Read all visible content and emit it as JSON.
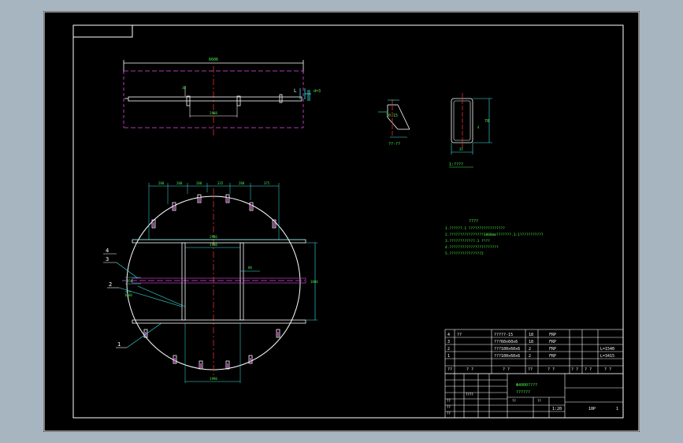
{
  "drawing": {
    "top_view": {
      "overall_dim": "6606",
      "left_tag": "30",
      "center_dim": "2988",
      "right_note": "d=3",
      "right_tag": "L"
    },
    "detail_a": {
      "dim": "70.15",
      "caption": "??-??"
    },
    "detail_b": {
      "caption": "1:????",
      "dim_h": "78",
      "dim_w": "35",
      "dim_side": "4"
    },
    "plan_view": {
      "top_dims": [
        "280",
        "280",
        "280",
        "335",
        "280",
        "375"
      ],
      "inner_dim": "2986",
      "mid_dim": "1900",
      "right_dim": "1884",
      "center_label": "80",
      "small_dim": "1060",
      "left_dim": "150",
      "bottom_dim": "1990",
      "callouts": [
        "4",
        "3",
        "2",
        "1"
      ]
    },
    "notes": {
      "title": "????",
      "lines": [
        "1.??????.1 ?????????????????",
        "2.????????????????3000mm???????.1:1???????????",
        "3.????????????.1 ????",
        "4.???????????????????????",
        "5.???????????????2"
      ]
    },
    "bom": {
      "rows": [
        {
          "no": "4",
          "code": "??",
          "name": "?????-15",
          "qty": "18",
          "mat": "FRP",
          "w1": "",
          "w2": "",
          "note": ""
        },
        {
          "no": "3",
          "code": "",
          "name": "???60x60x6",
          "qty": "18",
          "mat": "FRP",
          "w1": "",
          "w2": "",
          "note": ""
        },
        {
          "no": "2",
          "code": "",
          "name": "???100x60x6",
          "qty": "2",
          "mat": "FRP",
          "w1": "",
          "w2": "",
          "note": "L=1540"
        },
        {
          "no": "1",
          "code": "",
          "name": "???100x60x6",
          "qty": "2",
          "mat": "FRP",
          "w1": "",
          "w2": "",
          "note": "L=3415"
        }
      ],
      "header": {
        "no": "??",
        "code": "? ?",
        "name": "? ?",
        "qty": "??",
        "mat": "? ?",
        "w1": "? ?",
        "w2": "? ?",
        "note": "? ?"
      }
    },
    "title_block": {
      "drawing_name": "Φ4000????",
      "sub": "??????",
      "scale": "1:20",
      "sheet": "1",
      "code": "10P",
      "misc": [
        "????",
        "??",
        "??",
        "??",
        "??",
        "??"
      ]
    },
    "colors": {
      "green": "#4af04a",
      "cyan": "#3ee6e6",
      "magenta": "#e64de6",
      "white": "#ffffff",
      "red": "#e62e2e",
      "yellow": "#e6e63e"
    }
  }
}
